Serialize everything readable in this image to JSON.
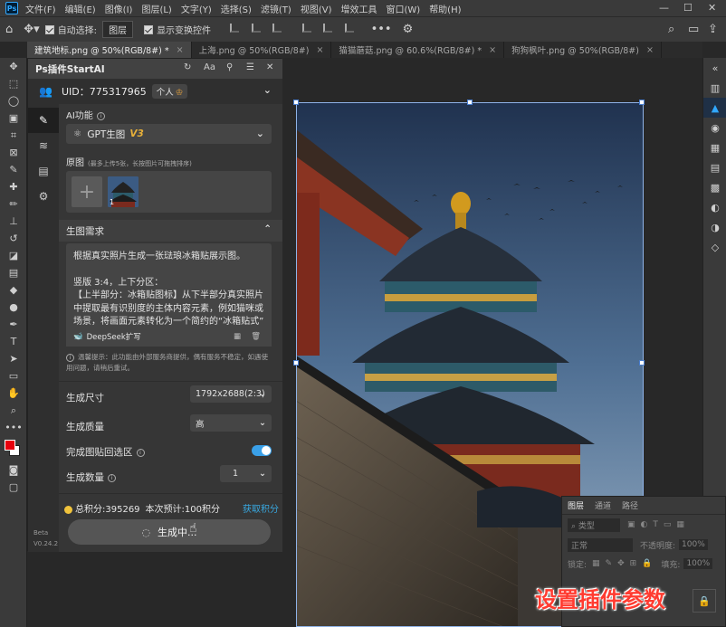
{
  "menubar": {
    "items": [
      "文件(F)",
      "编辑(E)",
      "图像(I)",
      "图层(L)",
      "文字(Y)",
      "选择(S)",
      "滤镜(T)",
      "视图(V)",
      "增效工具",
      "窗口(W)",
      "帮助(H)"
    ]
  },
  "options_bar": {
    "auto_select_label": "自动选择:",
    "auto_select_value": "图层",
    "show_transform_label": "显示变换控件"
  },
  "tabs": [
    {
      "label": "建筑地标.png @ 50%(RGB/8#) *",
      "active": true
    },
    {
      "label": "上海.png @ 50%(RGB/8#)",
      "active": false
    },
    {
      "label": "猫猫蘑菇.png @ 60.6%(RGB/8#) *",
      "active": false
    },
    {
      "label": "狗狗枫叶.png @ 50%(RGB/8#)",
      "active": false
    }
  ],
  "plugin": {
    "title": "Ps插件StartAI",
    "uid_text": "UID：775317965",
    "badge": "个人",
    "ai_function_label": "AI功能",
    "model_name": "GPT生图",
    "model_version": "V3",
    "source_label": "原图",
    "source_hint": "(最多上传5张，长按图片可拖拽排序)",
    "thumb_index": "1",
    "requirement_title": "生图需求",
    "requirement_lines": [
      "根据真实照片生成一张琺琅冰箱贴展示图。",
      "",
      "竖版 3:4，上下分区：",
      "【上半部分：冰箱贴图标】从下半部分真实照片中提取最有识别度的主体内容元素，例如猫咪或场景，将画面元素转化为一个简约的“冰箱贴式”"
    ],
    "deepseek_label": "DeepSeek扩写",
    "tip": "温馨提示：此功能由外部服务商提供，偶有服务不稳定，如遇使用问题，请稍后重试。",
    "size_label": "生成尺寸",
    "size_value": "1792x2688(2:3)",
    "quality_label": "生成质量",
    "quality_value": "高",
    "paste_label": "完成图贴回选区",
    "count_label": "生成数量",
    "count_value": "1",
    "credits_total": "总积分:395269",
    "credits_est": "本次预计:100积分",
    "get_credits": "获取积分",
    "generate_label": "生成中...",
    "beta_label": "Beta",
    "version_label": "V0.24.2"
  },
  "layers_panel": {
    "tabs": [
      "图层",
      "通道",
      "路径"
    ],
    "kind": "类型",
    "blend_mode": "正常",
    "opacity_label": "不透明度:",
    "opacity_value": "100%",
    "lock_label": "锁定:",
    "fill_label": "填充:",
    "fill_value": "100%"
  },
  "overlay_caption": "设置插件参数",
  "colors": {
    "accent": "#3aa0e8",
    "brand_v3": "#e8b039",
    "caption": "#ff3b30"
  }
}
